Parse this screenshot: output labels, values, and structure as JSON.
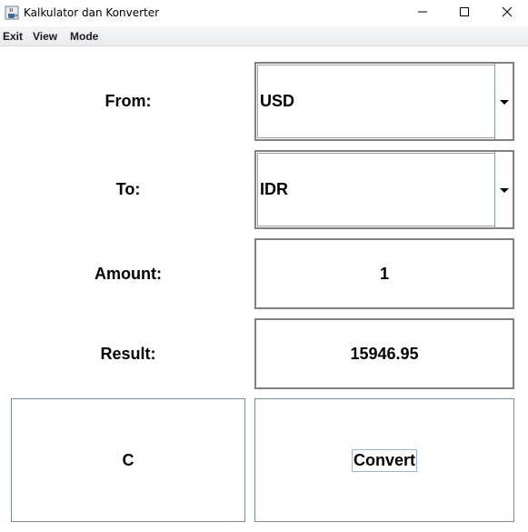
{
  "window": {
    "title": "Kalkulator dan Konverter",
    "icons": {
      "app": "java-cup-icon",
      "minimize": "minimize-icon",
      "maximize": "maximize-icon",
      "close": "close-icon"
    }
  },
  "menu": {
    "items": [
      "Exit",
      "View",
      "Mode"
    ]
  },
  "form": {
    "from_label": "From:",
    "to_label": "To:",
    "amount_label": "Amount:",
    "result_label": "Result:",
    "from_value": "USD",
    "to_value": "IDR",
    "amount_value": "1",
    "result_value": "15946.95"
  },
  "buttons": {
    "clear_label": "C",
    "convert_label": "Convert"
  }
}
